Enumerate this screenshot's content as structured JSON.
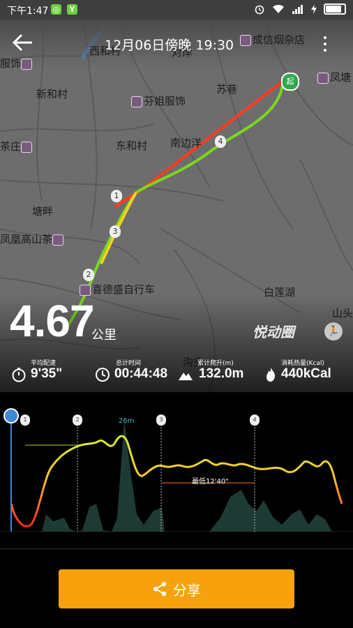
{
  "status_bar": {
    "time": "下午1:47",
    "app_badge_1": "◎",
    "app_badge_2": "Y"
  },
  "header": {
    "title": "12月06日傍晚 19:30"
  },
  "map": {
    "labels": [
      "西和村",
      "成信烟杂店",
      "对岸",
      "服饰",
      "新和村",
      "芬姐服饰",
      "苏巷",
      "凤塘",
      "茶庄",
      "东和村",
      "南边洋",
      "塘畔",
      "凤凰高山茶",
      "喜德盛自行车",
      "白莲湖",
      "山头",
      "沟头"
    ],
    "start_marker": "起",
    "km_markers": [
      "1",
      "2",
      "3",
      "4"
    ]
  },
  "summary": {
    "distance": "4.67",
    "distance_unit": "公里",
    "brand": "悦动圈"
  },
  "stats": [
    {
      "label": "平均配速",
      "value": "9'35\"",
      "icon": "stopwatch-icon"
    },
    {
      "label": "总计时间",
      "value": "00:44:48",
      "icon": "clock-icon"
    },
    {
      "label": "累计爬升(m)",
      "value": "132.0m",
      "icon": "mountain-icon"
    },
    {
      "label": "消耗热量(Kcal)",
      "value": "440kCal",
      "icon": "flame-icon"
    }
  ],
  "chart_data": {
    "type": "line",
    "peak_label": "26m",
    "min_pace_label": "最低12'40\"",
    "markers": [
      "1",
      "2",
      "3",
      "4"
    ],
    "colors": {
      "fast": "#ff3b1f",
      "mid": "#f5d020",
      "slow": "#7ad81e"
    }
  },
  "share": {
    "label": "分享"
  }
}
